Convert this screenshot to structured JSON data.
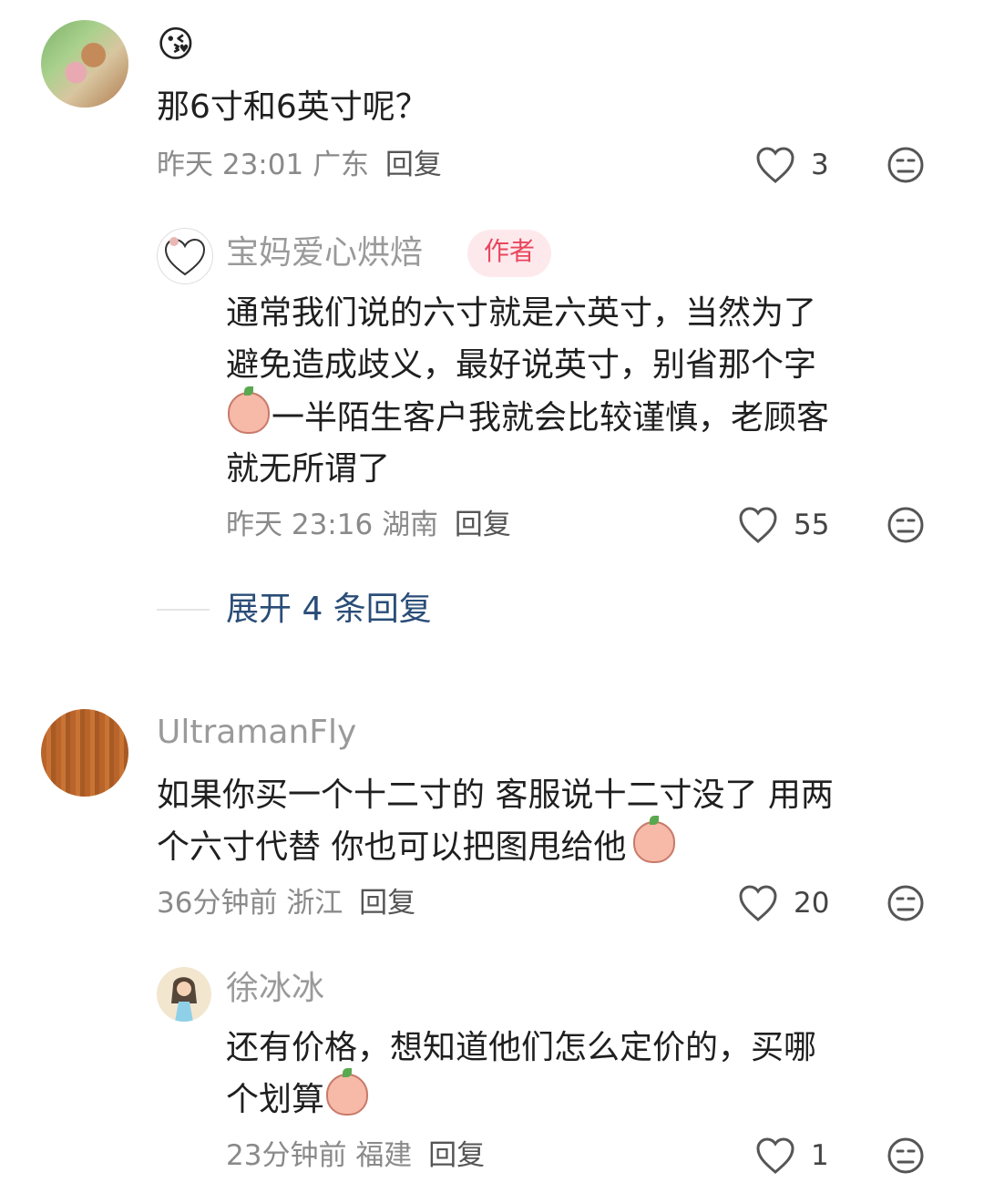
{
  "comments": [
    {
      "emoji": "😘",
      "text": "那6寸和6英寸呢？",
      "time": "昨天 23:01",
      "location": "广东",
      "reply_label": "回复",
      "likes": "3",
      "reply": {
        "username": "宝妈爱心烘焙",
        "badge": "作者",
        "line1": "通常我们说的六寸就是六英寸，当然为了",
        "line2": "避免造成歧义，最好说英寸，别省那个字",
        "line3": "一半陌生客户我就会比较谨慎，老顾客",
        "line4": "就无所谓了",
        "time": "昨天 23:16",
        "location": "湖南",
        "reply_label": "回复",
        "likes": "55"
      },
      "expand_label": "展开 4 条回复"
    },
    {
      "username": "UltramanFly",
      "line1": "如果你买一个十二寸的 客服说十二寸没了 用两",
      "line2": "个六寸代替 你也可以把图甩给他",
      "time": "36分钟前",
      "location": "浙江",
      "reply_label": "回复",
      "likes": "20",
      "reply": {
        "username": "徐冰冰",
        "line1": "还有价格，想知道他们怎么定价的，买哪",
        "line2": "个划算",
        "time": "23分钟前",
        "location": "福建",
        "reply_label": "回复",
        "likes": "1"
      }
    }
  ],
  "icons": {
    "like": "heart-outline-icon",
    "dislike": "neutral-face-icon"
  }
}
